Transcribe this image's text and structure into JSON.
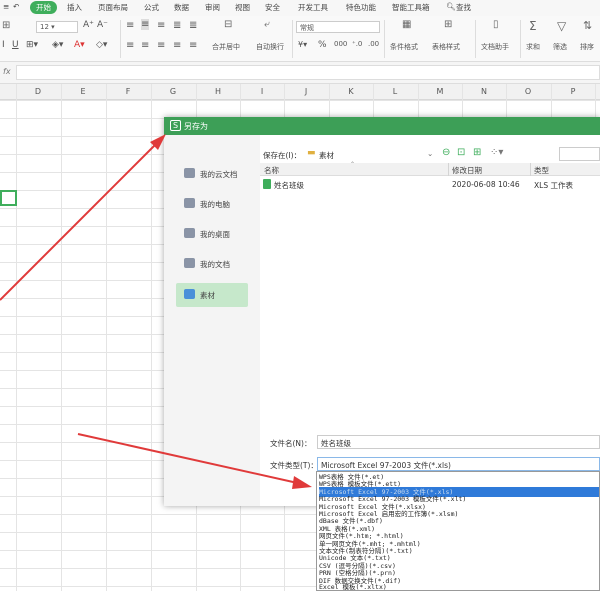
{
  "menu": {
    "items": [
      "开始",
      "插入",
      "页面布局",
      "公式",
      "数据",
      "审阅",
      "视图",
      "安全",
      "开发工具",
      "特色功能",
      "智能工具箱",
      "查找"
    ],
    "active_index": 0
  },
  "ribbon": {
    "font_size": "12",
    "number_format": "常规",
    "merge_center": "合并居中",
    "wrap_text": "自动换行",
    "cond_format": "条件格式",
    "table_style": "表格样式",
    "doc_helper": "文档助手",
    "sum": "求和",
    "filter": "筛选",
    "sort": "排序"
  },
  "formula_bar": {
    "fx": "fx"
  },
  "columns": [
    "D",
    "E",
    "F",
    "G",
    "H",
    "I",
    "J",
    "K",
    "L",
    "M",
    "N",
    "O",
    "P"
  ],
  "dialog": {
    "title": "另存为",
    "sidebar": [
      "我的云文档",
      "我的电脑",
      "我的桌面",
      "我的文档",
      "素材"
    ],
    "selected_sidebar": 4,
    "save_in_label": "保存在(I)：",
    "save_in_value": "素材",
    "list_headers": {
      "name": "名称",
      "modified": "修改日期",
      "type": "类型"
    },
    "files": [
      {
        "name": "姓名班级",
        "modified": "2020-06-08 10:46",
        "type": "XLS 工作表"
      }
    ],
    "filename_label": "文件名(N)：",
    "filename_value": "姓名班级",
    "filetype_label": "文件类型(T)：",
    "filetype_value": "Microsoft Excel 97-2003 文件(*.xls)"
  },
  "dropdown": {
    "options": [
      "WPS表格 文件(*.et)",
      "WPS表格 模板文件(*.ett)",
      "Microsoft Excel 97-2003 文件(*.xls)",
      "Microsoft Excel 97-2003 模板文件(*.xlt)",
      "Microsoft Excel 文件(*.xlsx)",
      "Microsoft Excel 启用宏的工作簿(*.xlsm)",
      "dBase 文件(*.dbf)",
      "XML 表格(*.xml)",
      "网页文件(*.htm; *.html)",
      "单一网页文件(*.mht; *.mhtml)",
      "文本文件(制表符分隔)(*.txt)",
      "Unicode 文本(*.txt)",
      "CSV (逗号分隔)(*.csv)",
      "PRN (空格分隔)(*.prn)",
      "DIF 数据交换文件(*.dif)",
      "Excel 模板(*.xltx)"
    ],
    "highlighted_index": 2
  },
  "colors": {
    "accent": "#3fae5c",
    "dialog_title": "#3d9f57",
    "arrow": "#e03a3a",
    "highlight": "#2f7ad9"
  }
}
